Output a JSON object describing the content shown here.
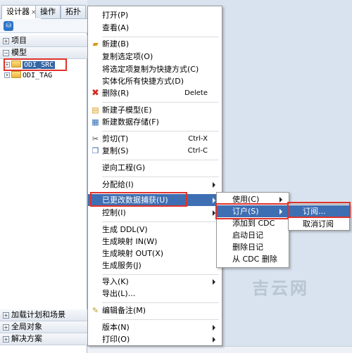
{
  "panel": {
    "tabs": [
      {
        "label": "设计器",
        "close": "×"
      },
      {
        "label": "操作"
      },
      {
        "label": "拓扑"
      }
    ],
    "tool_icon": "db-icon",
    "sections_top": [
      {
        "label": "项目",
        "state": "+"
      },
      {
        "label": "模型",
        "state": "−"
      }
    ],
    "tree": [
      {
        "label": "ODI_SRC",
        "selected": true
      },
      {
        "label": "ODI_TAG",
        "selected": false
      }
    ],
    "sections_bottom": [
      {
        "label": "加载计划和场景",
        "state": "+"
      },
      {
        "label": "全局对象",
        "state": "+"
      },
      {
        "label": "解决方案",
        "state": "+"
      }
    ]
  },
  "context_menu": {
    "items": [
      {
        "label": "打开(P)"
      },
      {
        "label": "查看(A)"
      },
      {
        "label": "新建(B)",
        "icon": "new-folder-icon"
      },
      {
        "label": "复制选定项(O)"
      },
      {
        "label": "将选定项复制为快捷方式(C)"
      },
      {
        "label": "实体化所有快捷方式(D)"
      },
      {
        "label": "删除(R)",
        "icon": "delete-icon",
        "shortcut": "Delete"
      },
      {
        "label": "新建子模型(E)",
        "icon": "submodel-icon"
      },
      {
        "label": "新建数据存储(F)",
        "icon": "datastore-icon"
      },
      {
        "label": "剪切(T)",
        "icon": "cut-icon",
        "shortcut": "Ctrl-X"
      },
      {
        "label": "复制(S)",
        "icon": "copy-icon",
        "shortcut": "Ctrl-C"
      },
      {
        "label": "逆向工程(G)"
      },
      {
        "label": "分配给(I)",
        "submenu": true
      },
      {
        "label": "已更改数据捕获(U)",
        "submenu": true,
        "highlighted": true
      },
      {
        "label": "控制(I)",
        "submenu": true
      },
      {
        "label": "生成 DDL(V)"
      },
      {
        "label": "生成映射 IN(W)"
      },
      {
        "label": "生成映射 OUT(X)"
      },
      {
        "label": "生成服务(J)"
      },
      {
        "label": "导入(K)",
        "submenu": true
      },
      {
        "label": "导出(L)..."
      },
      {
        "label": "编辑备注(M)",
        "icon": "memo-icon"
      },
      {
        "label": "版本(N)",
        "submenu": true
      },
      {
        "label": "打印(O)",
        "submenu": true
      }
    ]
  },
  "cdc_submenu": {
    "items": [
      {
        "label": "使用(C)",
        "submenu": true
      },
      {
        "label": "订户(S)",
        "submenu": true,
        "highlighted": true
      },
      {
        "label": "添加到 CDC"
      },
      {
        "label": "启动日记"
      },
      {
        "label": "删除日记"
      },
      {
        "label": "从 CDC 删除"
      }
    ]
  },
  "subscriber_submenu": {
    "items": [
      {
        "label": "订阅...",
        "highlighted": true
      },
      {
        "label": "取消订阅"
      }
    ]
  },
  "watermark": "吉云网",
  "colors": {
    "highlight": "#3f6fb3",
    "annotation": "#e0322a",
    "folder": "#e9b43e"
  }
}
